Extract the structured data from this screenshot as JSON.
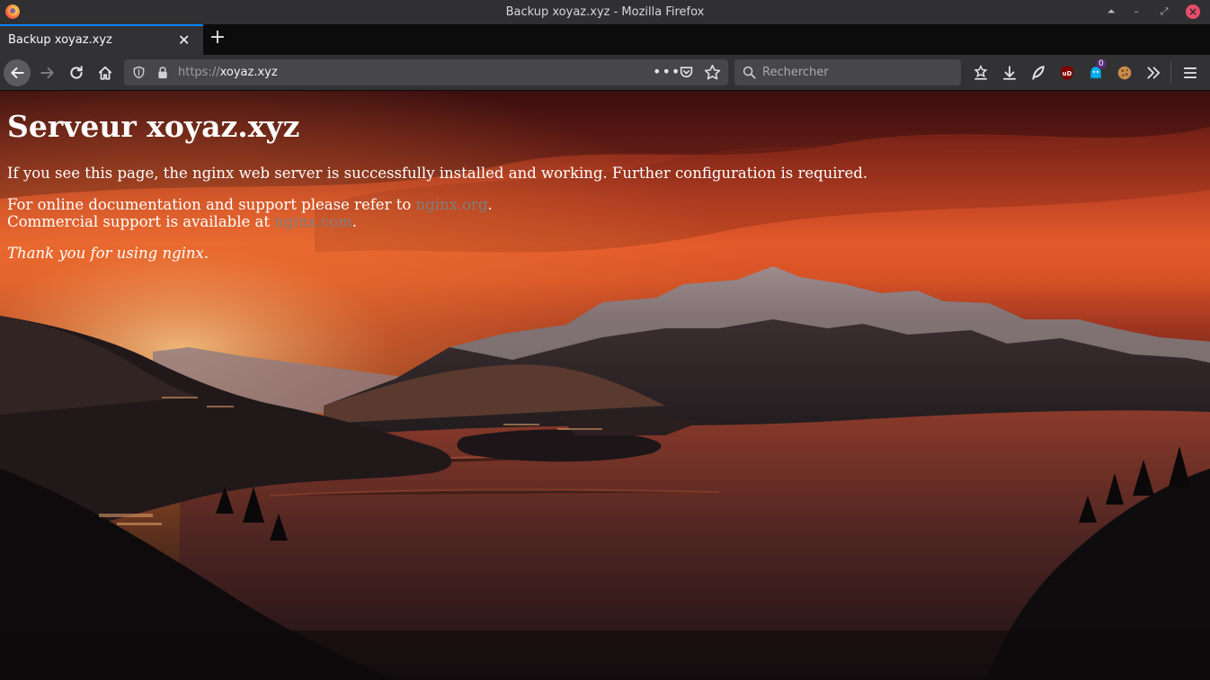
{
  "window": {
    "title": "Backup xoyaz.xyz - Mozilla Firefox"
  },
  "tabs": [
    {
      "label": "Backup xoyaz.xyz"
    }
  ],
  "urlbar": {
    "scheme": "https://",
    "host": "xoyaz.xyz"
  },
  "search": {
    "placeholder": "Rechercher"
  },
  "extensions": {
    "ghostery_badge": "0"
  },
  "page": {
    "heading": "Serveur xoyaz.xyz",
    "p1": "If you see this page, the nginx web server is successfully installed and working. Further configuration is required.",
    "p2_prefix": "For online documentation and support please refer to ",
    "link1": "nginx.org",
    "p2_suffix": ".",
    "p3_prefix": "Commercial support is available at ",
    "link2": "nginx.com",
    "p3_suffix": ".",
    "thanks": "Thank you for using nginx."
  },
  "colors": {
    "accent": "#0a84ff",
    "link": "#7f7f7f",
    "toolbar": "#323234"
  }
}
